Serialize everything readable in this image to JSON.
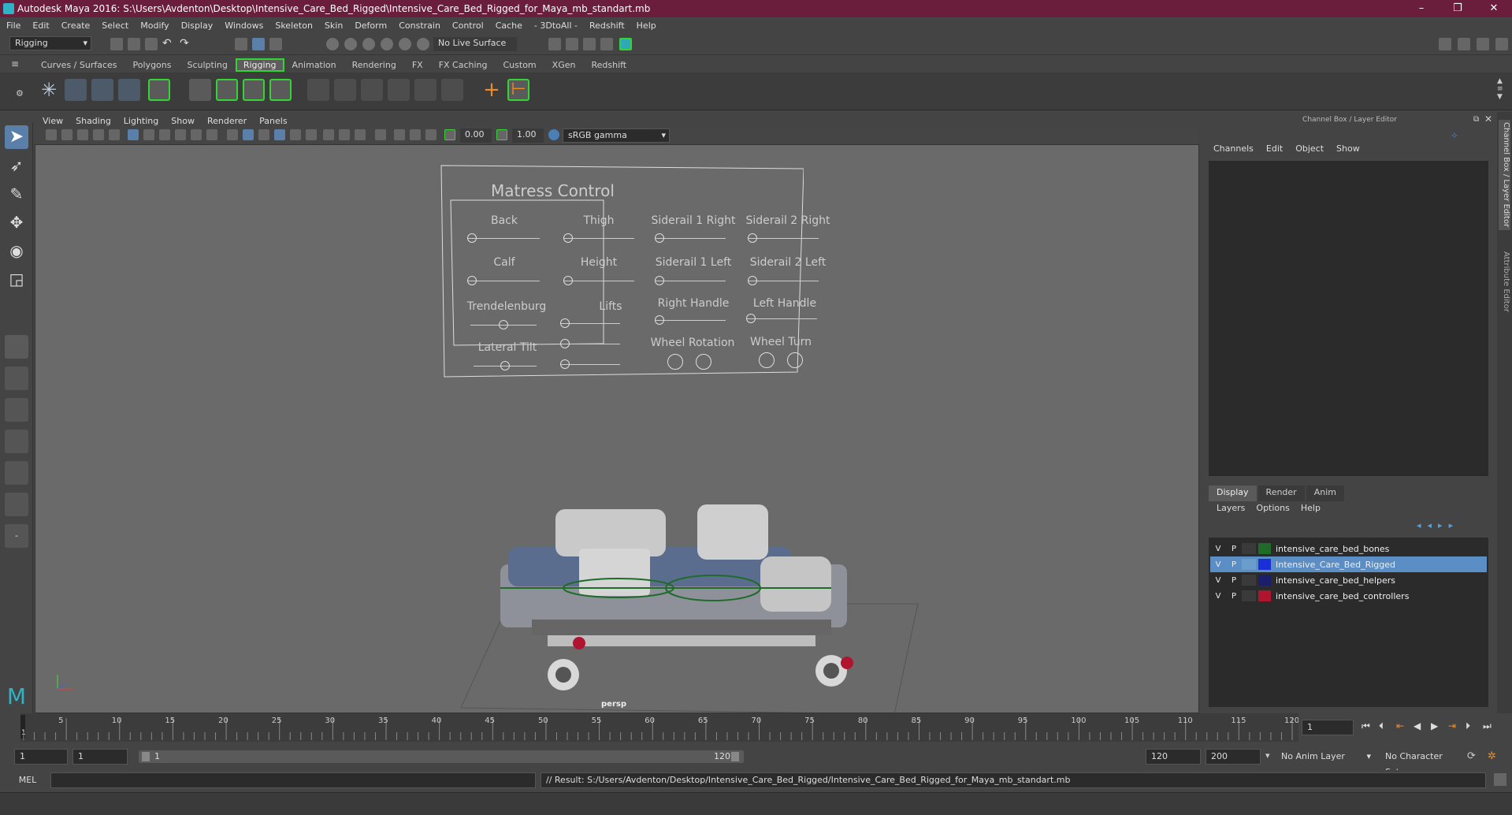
{
  "title": "Autodesk Maya 2016: S:\\Users\\Avdenton\\Desktop\\Intensive_Care_Bed_Rigged\\Intensive_Care_Bed_Rigged_for_Maya_mb_standart.mb",
  "window_controls": [
    "–",
    "❒",
    "✕"
  ],
  "menubar": [
    "File",
    "Edit",
    "Create",
    "Select",
    "Modify",
    "Display",
    "Windows",
    "Skeleton",
    "Skin",
    "Deform",
    "Constrain",
    "Control",
    "Cache",
    "- 3DtoAll -",
    "Redshift",
    "Help"
  ],
  "status": {
    "mode": "Rigging",
    "live_surface": "No Live Surface"
  },
  "shelf_tabs": [
    "Curves / Surfaces",
    "Polygons",
    "Sculpting",
    "Rigging",
    "Animation",
    "Rendering",
    "FX",
    "FX Caching",
    "Custom",
    "XGen",
    "Redshift"
  ],
  "active_shelf": "Rigging",
  "viewport_menu": [
    "View",
    "Shading",
    "Lighting",
    "Show",
    "Renderer",
    "Panels"
  ],
  "viewport_toolbar": {
    "exposure": "0.00",
    "gamma": "1.00",
    "color_space": "sRGB gamma"
  },
  "camera_label": "persp",
  "control_panel": {
    "title": "Matress Control",
    "sliders_left": [
      "Back",
      "Thigh",
      "Calf",
      "Height",
      "Trendelenburg",
      "Lifts",
      "Lateral Tilt"
    ],
    "sliders_right": [
      "Siderail 1 Right",
      "Siderail 2 Right",
      "Siderail 1 Left",
      "Siderail 2 Left",
      "Right Handle",
      "Left Handle",
      "Wheel Rotation",
      "Wheel Turn"
    ]
  },
  "channel_box": {
    "title": "Channel Box / Layer Editor",
    "menu": [
      "Channels",
      "Edit",
      "Object",
      "Show"
    ],
    "side_tabs": [
      "Channel Box / Layer Editor",
      "Attribute Editor"
    ]
  },
  "layer_editor": {
    "tabs": [
      "Display",
      "Render",
      "Anim"
    ],
    "active_tab": "Display",
    "menu": [
      "Layers",
      "Options",
      "Help"
    ],
    "layers": [
      {
        "v": "V",
        "p": "P",
        "color": "#1f6b2a",
        "name": "intensive_care_bed_bones",
        "selected": false
      },
      {
        "v": "V",
        "p": "P",
        "color": "#1a2fd6",
        "name": "Intensive_Care_Bed_Rigged",
        "selected": true
      },
      {
        "v": "V",
        "p": "P",
        "color": "#1b1f6b",
        "name": "intensive_care_bed_helpers",
        "selected": false
      },
      {
        "v": "V",
        "p": "P",
        "color": "#b01530",
        "name": "intensive_care_bed_controllers",
        "selected": false
      }
    ]
  },
  "timeline": {
    "ticks": [
      "5",
      "10",
      "15",
      "20",
      "25",
      "30",
      "35",
      "40",
      "45",
      "50",
      "55",
      "60",
      "65",
      "70",
      "75",
      "80",
      "85",
      "90",
      "95",
      "100",
      "105",
      "110",
      "115",
      "120"
    ],
    "current_marker": "1",
    "current_frame": "1"
  },
  "range": {
    "start": "1",
    "start2": "1",
    "slider_start": "1",
    "slider_end": "120",
    "end": "120",
    "end2": "200",
    "anim_layer": "No Anim Layer",
    "character_set": "No Character Set"
  },
  "command": {
    "lang": "MEL",
    "result": "// Result: S:/Users/Avdenton/Desktop/Intensive_Care_Bed_Rigged/Intensive_Care_Bed_Rigged_for_Maya_mb_standart.mb"
  },
  "colors": {
    "titlebar": "#6b1d3c",
    "accent_green": "#34d434",
    "selection": "#5a8ec5",
    "viewport_bg": "#6a6a6a"
  }
}
